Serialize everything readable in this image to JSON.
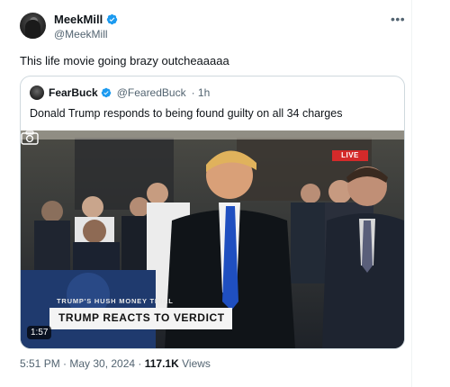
{
  "post": {
    "author": {
      "name": "MeekMill",
      "handle": "@MeekMill",
      "verified": true
    },
    "more_icon": "more-horizontal-icon",
    "text": "This life movie going brazy outcheaaaaa",
    "timestamp": "5:51 PM · May 30, 2024 · ",
    "views_count": "117.1K",
    "views_label": " Views"
  },
  "quoted_post": {
    "author": {
      "name": "FearBuck",
      "handle": "@FearedBuck",
      "verified": true
    },
    "time_ago": "· 1h",
    "text": "Donald Trump responds to being found guilty on all 34 charges",
    "video": {
      "live_badge": "LIVE",
      "lower_third_small": "TRUMP'S HUSH MONEY TRIAL",
      "lower_third_headline": "TRUMP REACTS TO VERDICT",
      "duration": "1:57",
      "camera_icon": "camera-icon"
    }
  },
  "colors": {
    "verified": "#1d9bf0",
    "live": "#d42a2a",
    "text": "#0f1419",
    "muted": "#536471"
  }
}
